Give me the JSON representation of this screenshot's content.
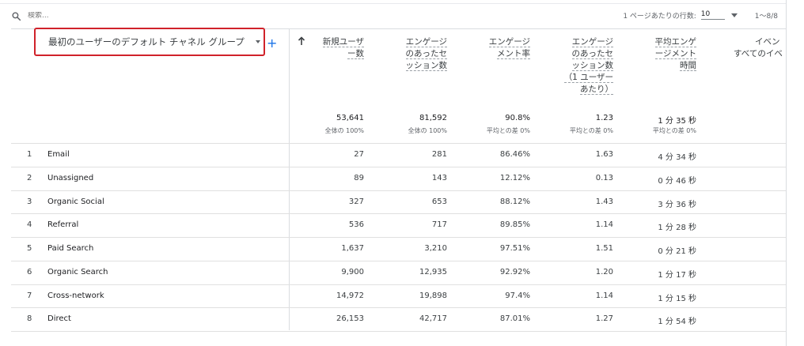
{
  "search": {
    "placeholder": "検索..."
  },
  "pager": {
    "rows_label": "1 ページあたりの行数:",
    "rows_value": "10",
    "range": "1～8/8"
  },
  "dimension": {
    "label": "最初のユーザーのデフォルト チャネル グループ"
  },
  "columns": [
    {
      "label_lines": [
        "新規ユーザ",
        "ー数"
      ],
      "total": "53,641",
      "sub": "全体の 100%"
    },
    {
      "label_lines": [
        "エンゲージ",
        "のあったセ",
        "ッション数"
      ],
      "total": "81,592",
      "sub": "全体の 100%"
    },
    {
      "label_lines": [
        "エンゲージ",
        "メント率"
      ],
      "total": "90.8%",
      "sub": "平均との差 0%"
    },
    {
      "label_lines": [
        "エンゲージ",
        "のあったセ",
        "ッション数",
        "（1 ユーザー",
        "あたり）"
      ],
      "total": "1.23",
      "sub": "平均との差 0%"
    },
    {
      "label_lines": [
        "平均エンゲ",
        "ージメント",
        "時間"
      ],
      "total": "1 分 35 秒",
      "sub": "平均との差 0%"
    },
    {
      "label_lines": [
        "イベン",
        "すべてのイベ"
      ],
      "total": "",
      "sub": ""
    }
  ],
  "rows": [
    {
      "idx": "1",
      "name": "Email",
      "v": [
        "27",
        "281",
        "86.46%",
        "1.63",
        "4 分 34 秒"
      ]
    },
    {
      "idx": "2",
      "name": "Unassigned",
      "v": [
        "89",
        "143",
        "12.12%",
        "0.13",
        "0 分 46 秒"
      ]
    },
    {
      "idx": "3",
      "name": "Organic Social",
      "v": [
        "327",
        "653",
        "88.12%",
        "1.43",
        "3 分 36 秒"
      ]
    },
    {
      "idx": "4",
      "name": "Referral",
      "v": [
        "536",
        "717",
        "89.85%",
        "1.14",
        "1 分 28 秒"
      ]
    },
    {
      "idx": "5",
      "name": "Paid Search",
      "v": [
        "1,637",
        "3,210",
        "97.51%",
        "1.51",
        "0 分 21 秒"
      ]
    },
    {
      "idx": "6",
      "name": "Organic Search",
      "v": [
        "9,900",
        "12,935",
        "92.92%",
        "1.20",
        "1 分 17 秒"
      ]
    },
    {
      "idx": "7",
      "name": "Cross-network",
      "v": [
        "14,972",
        "19,898",
        "97.4%",
        "1.14",
        "1 分 15 秒"
      ]
    },
    {
      "idx": "8",
      "name": "Direct",
      "v": [
        "26,153",
        "42,717",
        "87.01%",
        "1.27",
        "1 分 54 秒"
      ]
    }
  ],
  "colors": {
    "highlight_border": "#d0222a",
    "accent": "#1a73e8"
  }
}
